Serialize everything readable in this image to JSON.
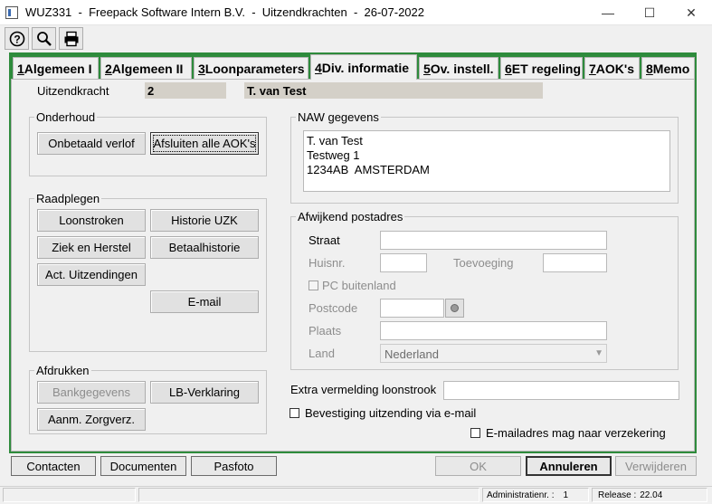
{
  "window": {
    "title": "WUZ331  -  Freepack Software Intern B.V.  -  Uitzendkrachten  -  26-07-2022",
    "minimize_glyph": "—",
    "maximize_glyph": "☐",
    "close_glyph": "✕"
  },
  "toolbar": {
    "help_icon": "help-icon",
    "search_icon": "search-icon",
    "print_icon": "print-icon"
  },
  "tabs": [
    {
      "num": "1",
      "label": " Algemeen I"
    },
    {
      "num": "2",
      "label": " Algemeen II"
    },
    {
      "num": "3",
      "label": " Loonparameters"
    },
    {
      "num": "4",
      "label": " Div. informatie"
    },
    {
      "num": "5",
      "label": " Ov. instell."
    },
    {
      "num": "6",
      "label": " ET regeling"
    },
    {
      "num": "7",
      "label": " AOK's"
    },
    {
      "num": "8",
      "label": " Memo"
    }
  ],
  "header": {
    "label": "Uitzendkracht",
    "number": "2",
    "name": "T. van Test"
  },
  "onderhoud": {
    "title": "Onderhoud",
    "onbetaald_verlof": "Onbetaald verlof",
    "afsluiten_aoks": "Afsluiten alle AOK's"
  },
  "raadplegen": {
    "title": "Raadplegen",
    "loonstroken": "Loonstroken",
    "historie_uzk": "Historie UZK",
    "ziek_en_herstel": "Ziek en Herstel",
    "betaalhistorie": "Betaalhistorie",
    "act_uitzendingen": "Act. Uitzendingen",
    "email": "E-mail"
  },
  "afdrukken": {
    "title": "Afdrukken",
    "bankgegevens": "Bankgegevens",
    "lb_verklaring": "LB-Verklaring",
    "aanm_zorgverz": "Aanm. Zorgverz."
  },
  "naw": {
    "title": "NAW gegevens",
    "line1": "T. van Test",
    "line2": "Testweg 1",
    "line3": "1234AB  AMSTERDAM"
  },
  "afwijkend": {
    "title": "Afwijkend postadres",
    "straat": "Straat",
    "huisnr": "Huisnr.",
    "toevoeging": "Toevoeging",
    "pc_buitenland": "PC buitenland",
    "postcode": "Postcode",
    "plaats": "Plaats",
    "land": "Land",
    "land_value": "Nederland"
  },
  "extra": {
    "loonstrook_label": "Extra vermelding loonstrook",
    "bevestiging": "Bevestiging uitzending via e-mail",
    "emailadres_verzekering": "E-mailadres mag naar verzekering"
  },
  "bottom": {
    "contacten": "Contacten",
    "documenten": "Documenten",
    "pasfoto": "Pasfoto",
    "ok": "OK",
    "annuleren": "Annuleren",
    "verwijderen": "Verwijderen"
  },
  "status": {
    "administratie_label": "Administratienr. :",
    "administratie_value": "1",
    "release_label": "Release :",
    "release_value": "22.04"
  },
  "colors": {
    "frame_green": "#2e8b3c",
    "panel": "#f0f0f0",
    "readonly_field": "#d4d0c8"
  }
}
